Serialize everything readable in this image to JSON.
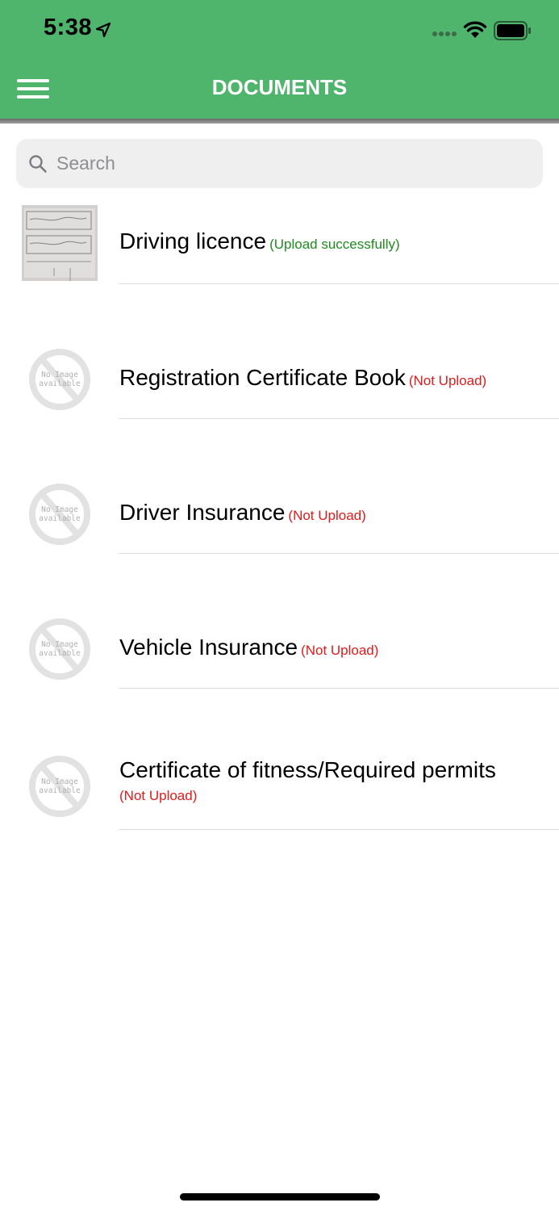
{
  "status_bar": {
    "time": "5:38"
  },
  "header": {
    "title": "DOCUMENTS",
    "accent_color": "#4fb46c",
    "menu_icon": "hamburger-menu-icon"
  },
  "search": {
    "placeholder": "Search",
    "value": ""
  },
  "documents": [
    {
      "name": "Driving licence",
      "status": "(Upload successfully)",
      "status_color": "#1f8a1f",
      "thumbnail": "document-photo"
    },
    {
      "name": "Registration Certificate Book",
      "status": "(Not Upload)",
      "status_color": "#e01b1b",
      "thumbnail": "no-image-available"
    },
    {
      "name": "Driver Insurance",
      "status": "(Not Upload)",
      "status_color": "#e01b1b",
      "thumbnail": "no-image-available"
    },
    {
      "name": "Vehicle Insurance",
      "status": "(Not Upload)",
      "status_color": "#e01b1b",
      "thumbnail": "no-image-available"
    },
    {
      "name": "Certificate of fitness/Required permits",
      "status": "(Not Upload)",
      "status_color": "#e01b1b",
      "thumbnail": "no-image-available"
    }
  ],
  "placeholder_image": {
    "line1": "No Image",
    "line2": "available"
  }
}
